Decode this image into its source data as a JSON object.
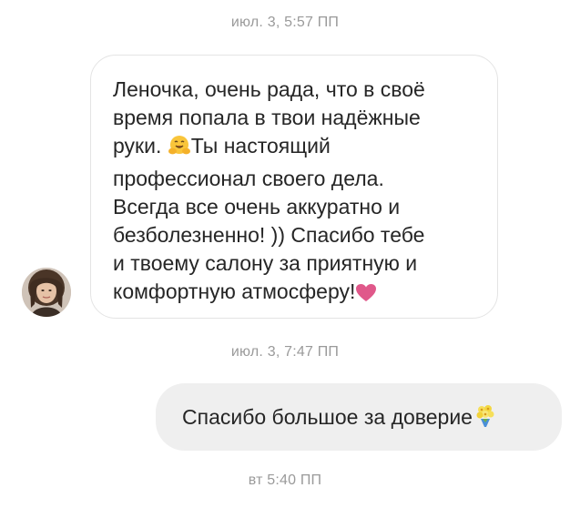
{
  "timestamps": {
    "first": "июл. 3, 5:57 ПП",
    "second": "июл. 3, 7:47 ПП",
    "third": "вт 5:40 ПП"
  },
  "incoming": {
    "line1": "Леночка, очень рада, что в своё",
    "line2": "время попала в твои надёжные",
    "line3_before": "руки. ",
    "line3_after": "Ты настоящий",
    "line4": "профессионал своего дела.",
    "line5": "Всегда все очень аккуратно и",
    "line6": "безболезненно! )) Спасибо тебе",
    "line7": "и твоему салону за приятную и",
    "line8": "комфортную атмосферу!",
    "emoji_mid": "hugging-face-emoji",
    "emoji_end": "pink-heart-emoji"
  },
  "outgoing": {
    "text": "Спасибо большое за доверие",
    "emoji": "bouquet-emoji"
  },
  "colors": {
    "timestamp": "#9a9a9a",
    "incoming_border": "#e4e4e4",
    "outgoing_bg": "#efefef",
    "heart": "#e0588a"
  }
}
